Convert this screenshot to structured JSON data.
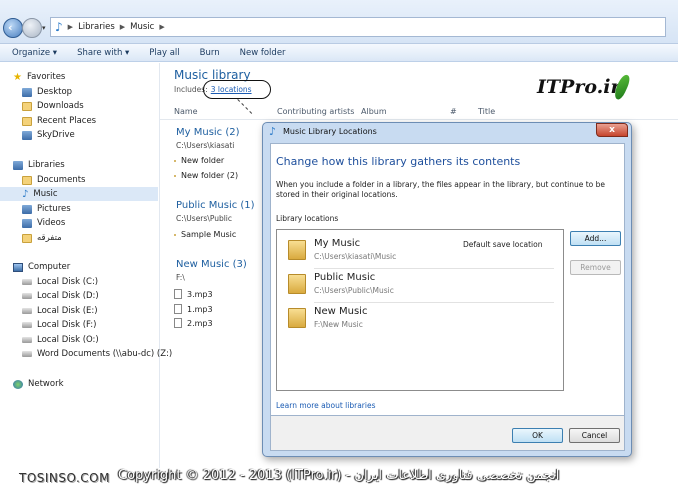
{
  "address_bar": {
    "path": [
      "Libraries",
      "Music"
    ]
  },
  "toolbar": {
    "items": [
      "Organize ▾",
      "Share with ▾",
      "Play all",
      "Burn",
      "New folder"
    ]
  },
  "nav": {
    "favorites": {
      "label": "Favorites",
      "items": [
        "Desktop",
        "Downloads",
        "Recent Places",
        "SkyDrive"
      ]
    },
    "libraries": {
      "label": "Libraries",
      "items": [
        "Documents",
        "Music",
        "Pictures",
        "Videos",
        "متفرقه"
      ]
    },
    "computer": {
      "label": "Computer",
      "items": [
        "Local Disk (C:)",
        "Local Disk (D:)",
        "Local Disk (E:)",
        "Local Disk (F:)",
        "Local Disk (O:)",
        "Word Documents (\\\\abu-dc) (Z:)"
      ]
    },
    "network": {
      "label": "Network"
    }
  },
  "library": {
    "title": "Music library",
    "includes_label": "Includes:",
    "includes_link": "3 locations"
  },
  "columns": [
    "Name",
    "Contributing artists",
    "Album",
    "#",
    "Title"
  ],
  "groups": [
    {
      "title": "My Music (2)",
      "path": "C:\\Users\\kiasati",
      "files": [
        "New folder",
        "New folder (2)"
      ]
    },
    {
      "title": "Public Music (1)",
      "path": "C:\\Users\\Public",
      "files": [
        "Sample Music"
      ]
    },
    {
      "title": "New Music (3)",
      "path": "F:\\",
      "files": [
        "3.mp3",
        "1.mp3",
        "2.mp3"
      ]
    }
  ],
  "watermark": "ITPro.ir",
  "dialog": {
    "title": "Music Library Locations",
    "close": "x",
    "heading": "Change how this library gathers its contents",
    "description": "When you include a folder in a library, the files appear in the library, but continue to be stored in their original locations.",
    "list_label": "Library locations",
    "locations": [
      {
        "name": "My Music",
        "path": "C:\\Users\\kiasati\\Music",
        "note": "Default save location"
      },
      {
        "name": "Public Music",
        "path": "C:\\Users\\Public\\Music",
        "note": ""
      },
      {
        "name": "New Music",
        "path": "F:\\New Music",
        "note": ""
      }
    ],
    "add_button": "Add...",
    "remove_button": "Remove",
    "learn_link": "Learn more about libraries",
    "ok_button": "OK",
    "cancel_button": "Cancel"
  },
  "footer": {
    "site": "TOSINSO.COM",
    "copyright": "Copyright © 2012 - 2013 (ITPro.ir) - انجمن تخصصی فناوری اطلاعات ایران"
  }
}
